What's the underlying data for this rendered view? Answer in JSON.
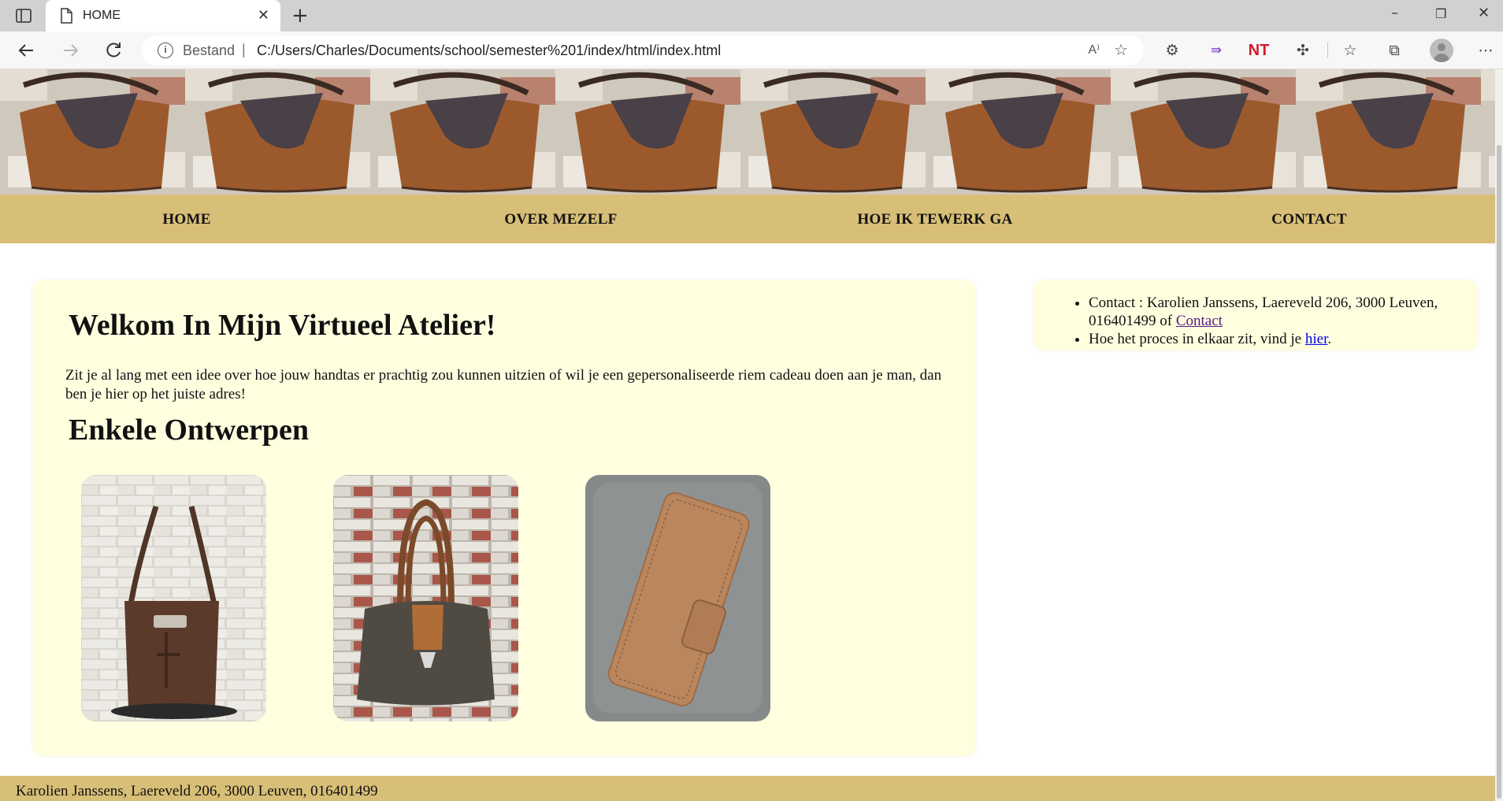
{
  "browser": {
    "tab_title": "HOME",
    "address_scheme": "Bestand",
    "address_separator": "|",
    "address_url": "C:/Users/Charles/Documents/school/semester%201/index/html/index.html",
    "read_aloud": "A⁾",
    "extension_nt_label": "NT",
    "extension_nt_color": "#d11a2a"
  },
  "nav": {
    "items": [
      {
        "label": "HOME"
      },
      {
        "label": "OVER MEZELF"
      },
      {
        "label": "HOE IK TEWERK GA"
      },
      {
        "label": "CONTACT"
      }
    ]
  },
  "main": {
    "heading": "Welkom In Mijn Virtueel Atelier!",
    "intro": "Zit je al lang met een idee over hoe jouw handtas er prachtig zou kunnen uitzien of wil je een gepersonaliseerde riem cadeau doen aan je man, dan ben je hier op het juiste adres!",
    "designs_heading": "Enkele Ontwerpen"
  },
  "sidebar": {
    "contact_prefix": "Contact : Karolien Janssens, Laereveld 206, 3000 Leuven, 016401499 of ",
    "contact_link": "Contact",
    "process_prefix": "Hoe het proces in elkaar zit, vind je ",
    "process_link": "hier",
    "process_suffix": "."
  },
  "footer": {
    "text": "Karolien Janssens, Laereveld 206, 3000 Leuven, 016401499"
  },
  "colors": {
    "nav_background": "#d8bf77",
    "card_background": "#ffffe0",
    "link": "#0000ee",
    "visited_link": "#551a8b"
  }
}
